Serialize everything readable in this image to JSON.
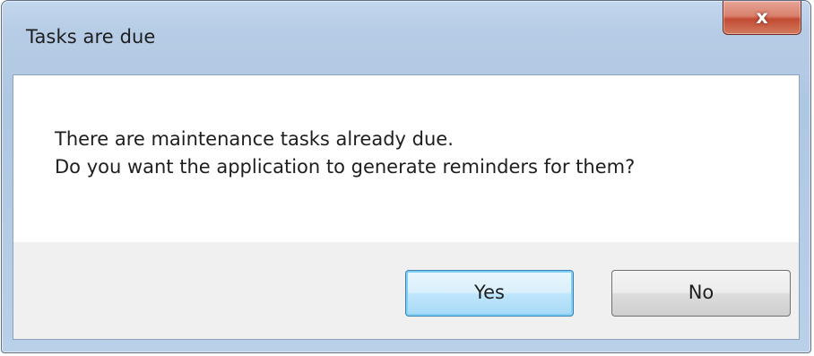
{
  "dialog": {
    "title": "Tasks are due",
    "close_glyph": "x",
    "message_line1": "There are maintenance tasks already due.",
    "message_line2": "Do you want the application to generate reminders for them?",
    "buttons": {
      "yes_label": "Yes",
      "no_label": "No"
    },
    "icons": {
      "close": "close-icon"
    },
    "colors": {
      "frame": "#b7cde6",
      "close_button": "#c24b33",
      "default_button_border": "#3c7fb1",
      "button_area": "#f0f0f0"
    }
  }
}
